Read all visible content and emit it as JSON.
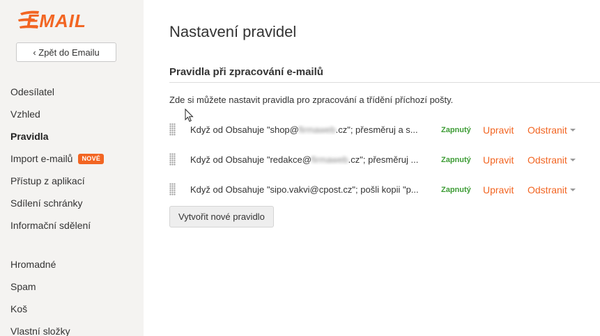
{
  "brand": {
    "logo_text": "EMAIL",
    "accent_color": "#f26522"
  },
  "sidebar": {
    "back_label": "‹ Zpět do Emailu",
    "items_primary": [
      {
        "label": "Odesílatel"
      },
      {
        "label": "Vzhled"
      },
      {
        "label": "Pravidla",
        "active": true
      },
      {
        "label": "Import e-mailů",
        "badge": "NOVÉ"
      },
      {
        "label": "Přístup z aplikací"
      },
      {
        "label": "Sdílení schránky"
      },
      {
        "label": "Informační sdělení"
      }
    ],
    "items_secondary": [
      {
        "label": "Hromadné"
      },
      {
        "label": "Spam"
      },
      {
        "label": "Koš"
      },
      {
        "label": "Vlastní složky"
      }
    ]
  },
  "main": {
    "title": "Nastavení pravidel",
    "section_title": "Pravidla při zpracování e-mailů",
    "description": "Zde si můžete nastavit pravidla pro zpracování a třídění příchozí pošty.",
    "rules": [
      {
        "prefix": "Když od Obsahuje \"shop@",
        "blurred": "firmaweb",
        "suffix": ".cz\"; přesměruj a s...",
        "status": "Zapnutý",
        "edit_label": "Upravit",
        "delete_label": "Odstranit"
      },
      {
        "prefix": "Když od Obsahuje \"redakce@",
        "blurred": "firmaweb",
        "suffix": ".cz\"; přesměruj ...",
        "status": "Zapnutý",
        "edit_label": "Upravit",
        "delete_label": "Odstranit"
      },
      {
        "prefix": "Když od Obsahuje \"sipo.vakvi@cpost.cz\"; pošli kopii \"p...",
        "blurred": "",
        "suffix": "",
        "status": "Zapnutý",
        "edit_label": "Upravit",
        "delete_label": "Odstranit"
      }
    ],
    "create_label": "Vytvořit nové pravidlo"
  }
}
